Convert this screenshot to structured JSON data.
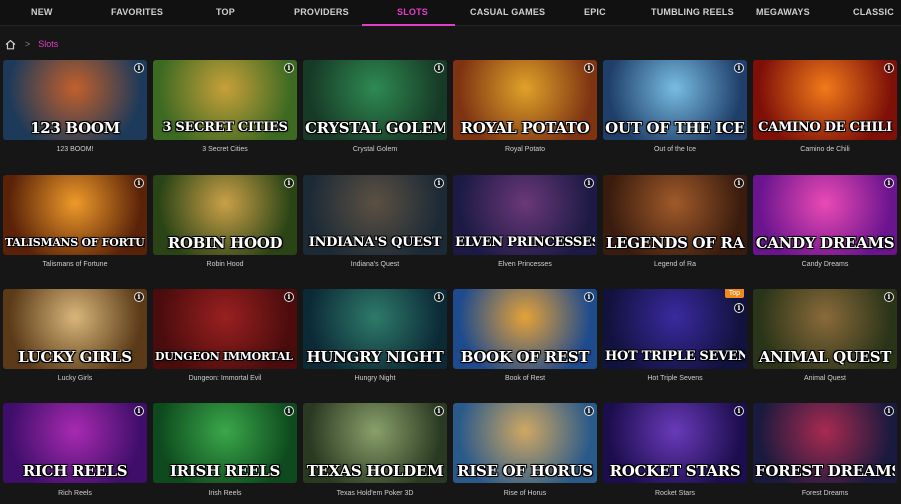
{
  "nav": {
    "items": [
      "NEW",
      "FAVORITES",
      "TOP",
      "PROVIDERS",
      "SLOTS",
      "CASUAL GAMES",
      "EPIC",
      "TUMBLING REELS",
      "MEGAWAYS",
      "CLASSIC"
    ],
    "active": "SLOTS",
    "accent": "#e040c8"
  },
  "breadcrumb": {
    "home_icon": "home-icon",
    "separator": ">",
    "current": "Slots"
  },
  "games": [
    {
      "title": "123 BOOM!",
      "logo": "123 BOOM",
      "colors": [
        "#1d3a5a",
        "#c2602a"
      ]
    },
    {
      "title": "3 Secret Cities",
      "logo": "3 SECRET CITIES",
      "colors": [
        "#3d6a22",
        "#c7a03a"
      ]
    },
    {
      "title": "Crystal Golem",
      "logo": "CRYSTAL GOLEM",
      "colors": [
        "#173a26",
        "#2e8a52"
      ]
    },
    {
      "title": "Royal Potato",
      "logo": "ROYAL POTATO",
      "colors": [
        "#7e3412",
        "#e0a22a"
      ]
    },
    {
      "title": "Out of the Ice",
      "logo": "OUT OF THE ICE",
      "colors": [
        "#1f3f6a",
        "#78bce2"
      ]
    },
    {
      "title": "Camino de Chili",
      "logo": "CAMINO DE CHILI",
      "colors": [
        "#7e1008",
        "#f07a1a"
      ]
    },
    {
      "title": "Talismans of Fortune",
      "logo": "TALISMANS OF FORTUNE",
      "colors": [
        "#5a2208",
        "#ee9a2a"
      ]
    },
    {
      "title": "Robin Hood",
      "logo": "ROBIN HOOD",
      "colors": [
        "#2a4416",
        "#caa048"
      ]
    },
    {
      "title": "Indiana's Quest",
      "logo": "INDIANA'S QUEST",
      "colors": [
        "#1c2a36",
        "#5c5042"
      ]
    },
    {
      "title": "Elven Princesses",
      "logo": "ELVEN PRINCESSES",
      "colors": [
        "#1c1a44",
        "#6a3878"
      ]
    },
    {
      "title": "Legend of Ra",
      "logo": "LEGENDS OF RA",
      "colors": [
        "#3a1c0e",
        "#a05a2a"
      ]
    },
    {
      "title": "Candy Dreams",
      "logo": "CANDY DREAMS",
      "colors": [
        "#6a148e",
        "#ea4ab4"
      ]
    },
    {
      "title": "Lucky Girls",
      "logo": "LUCKY GIRLS",
      "colors": [
        "#5a3a18",
        "#d8b67a"
      ]
    },
    {
      "title": "Dungeon: Immortal Evil",
      "logo": "DUNGEON IMMORTAL EVIL",
      "colors": [
        "#4a0c0c",
        "#9a2020"
      ]
    },
    {
      "title": "Hungry Night",
      "logo": "HUNGRY NIGHT",
      "colors": [
        "#0c2a36",
        "#2e7a6a"
      ]
    },
    {
      "title": "Book of Rest",
      "logo": "BOOK OF REST",
      "colors": [
        "#1e4a8e",
        "#e4a238"
      ]
    },
    {
      "title": "Hot Triple Sevens",
      "logo": "HOT TRIPLE SEVENS",
      "colors": [
        "#12123e",
        "#3a2aa0"
      ],
      "badge": "Top"
    },
    {
      "title": "Animal Quest",
      "logo": "ANIMAL QUEST",
      "colors": [
        "#2a3418",
        "#8a6a3a"
      ]
    },
    {
      "title": "Rich Reels",
      "logo": "RICH REELS",
      "colors": [
        "#3e0e6a",
        "#a82ab0"
      ]
    },
    {
      "title": "Irish Reels",
      "logo": "IRISH REELS",
      "colors": [
        "#0e4a1e",
        "#3aa84a"
      ]
    },
    {
      "title": "Texas Hold'em Poker 3D",
      "logo": "TEXAS HOLDEM",
      "colors": [
        "#2a3a22",
        "#8aa06a"
      ]
    },
    {
      "title": "Rise of Horus",
      "logo": "RISE OF HORUS",
      "colors": [
        "#2a5a8a",
        "#cfa862"
      ]
    },
    {
      "title": "Rocket Stars",
      "logo": "ROCKET STARS",
      "colors": [
        "#1c0e4e",
        "#6a3aba"
      ]
    },
    {
      "title": "Forest Dreams",
      "logo": "FOREST DREAMS",
      "colors": [
        "#1a1a3e",
        "#a82a50"
      ]
    }
  ]
}
